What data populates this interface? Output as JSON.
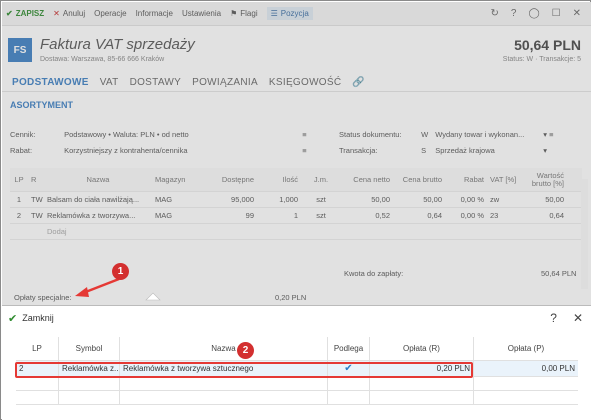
{
  "toolbar": {
    "save": "ZAPISZ",
    "cancel": "Anuluj",
    "operations": "Operacje",
    "information": "Informacje",
    "settings": "Ustawienia",
    "flags": "Flagi",
    "position": "Pozycja"
  },
  "header": {
    "badge": "FS",
    "title": "Faktura VAT sprzedaży",
    "subtitle": "Dostawa: Warszawa, 85-66 666 Kraków",
    "total": "50,64 PLN",
    "status": "Status: W  ·  Transakcje: 5"
  },
  "tabs": [
    "PODSTAWOWE",
    "VAT",
    "DOSTAWY",
    "POWIĄZANIA",
    "KSIĘGOWOŚĆ"
  ],
  "section_title": "ASORTYMENT",
  "fields": {
    "cennik_label": "Cennik:",
    "cennik_value": "Podstawowy • Waluta: PLN • od netto",
    "rabat_label": "Rabat:",
    "rabat_value": "Korzystniejszy z kontrahenta/cennika",
    "status_label": "Status dokumentu:",
    "status_code": "W",
    "status_value": "Wydany towar i wykonan...",
    "transakcja_label": "Transakcja:",
    "transakcja_code": "S",
    "transakcja_value": "Sprzedaż krajowa"
  },
  "grid": {
    "headers": [
      "LP",
      "R",
      "Nazwa",
      "Magazyn",
      "Dostępne",
      "Ilość",
      "J.m.",
      "Cena netto",
      "Cena brutto",
      "Rabat",
      "VAT [%]",
      "Wartość brutto [%]"
    ],
    "rows": [
      [
        "1",
        "TW",
        "Balsam do ciała nawilżają...",
        "MAG",
        "95,000",
        "1,000",
        "szt",
        "50,00",
        "50,00",
        "0,00 %",
        "zw",
        "50,00"
      ],
      [
        "2",
        "TW",
        "Reklamówka z tworzywa...",
        "MAG",
        "99",
        "1",
        "szt",
        "0,52",
        "0,64",
        "0,00 %",
        "23",
        "0,64"
      ]
    ],
    "new_row": "Dodaj"
  },
  "kwota_label": "Kwota do zapłaty:",
  "kwota_value": "50,64 PLN",
  "oplaty_label": "Opłaty specjalne:",
  "oplaty_value": "0,20 PLN",
  "badges": [
    "1",
    "2"
  ],
  "popup": {
    "close_label": "Zamknij",
    "help": "?",
    "close_x": "✕",
    "headers": [
      "LP",
      "Symbol",
      "Nazwa",
      "Podlega",
      "Opłata (R)",
      "Opłata (P)"
    ],
    "row": {
      "lp": "2",
      "symbol": "Reklamówka z...",
      "nazwa": "Reklamówka z tworzywa sztucznego",
      "podlega": true,
      "oplata_r": "0,20 PLN",
      "oplata_p": "0,00 PLN"
    }
  },
  "colors": {
    "accent": "#3b7fc4",
    "highlight": "#e53935",
    "badge": "#d32f2f"
  }
}
